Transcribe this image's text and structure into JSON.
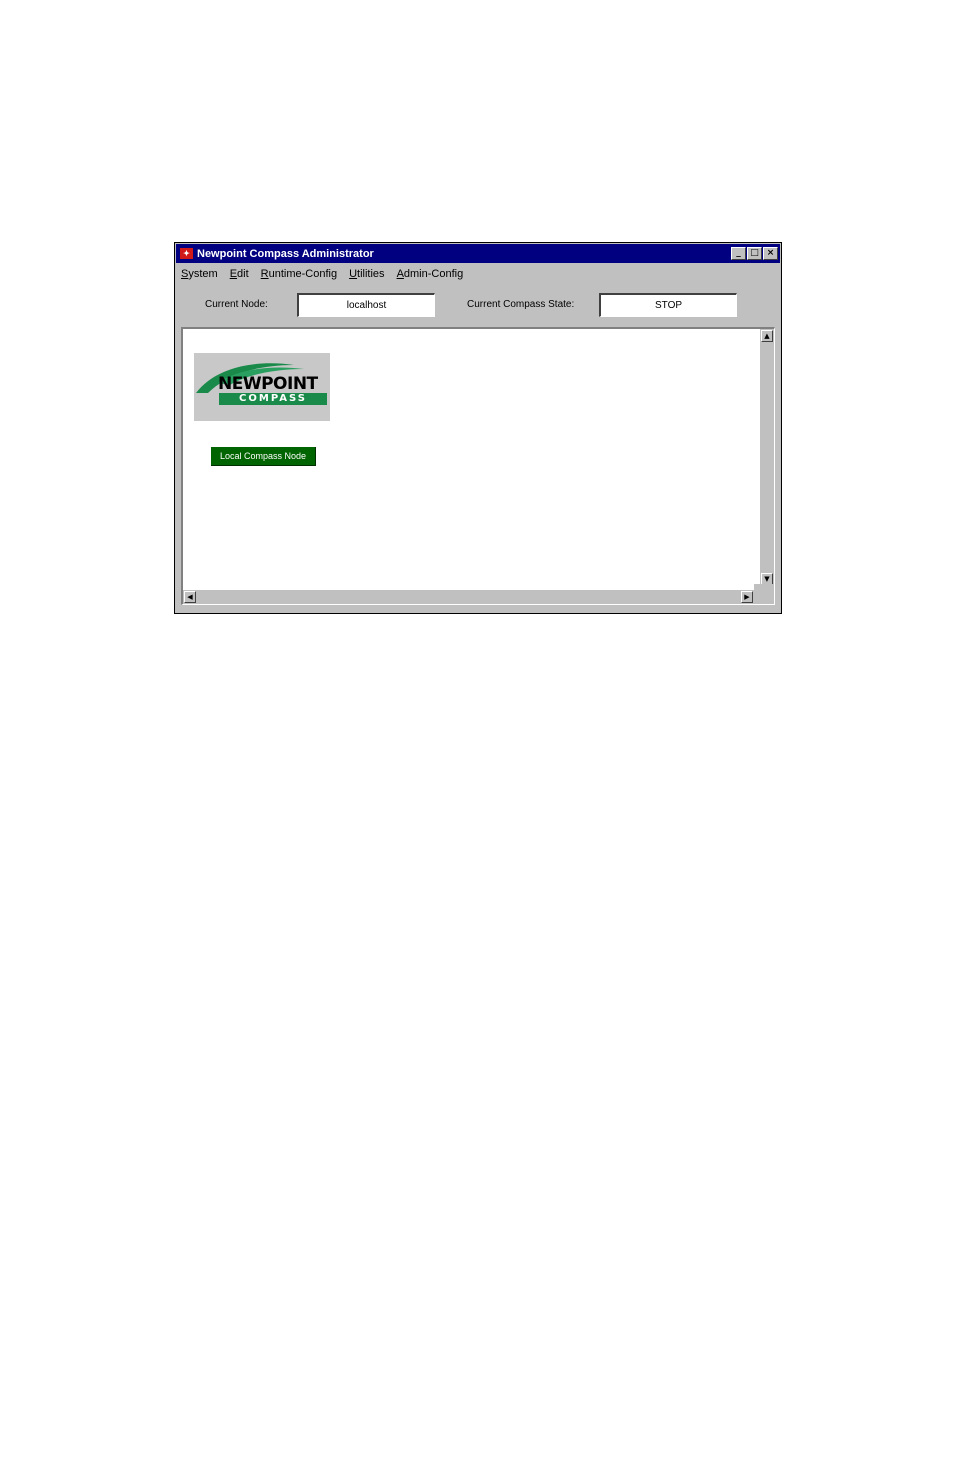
{
  "window": {
    "title": "Newpoint Compass Administrator",
    "app_icon": "app-icon",
    "controls": {
      "minimize": "_",
      "maximize": "□",
      "close": "×"
    }
  },
  "menu": [
    {
      "underline": "S",
      "rest": "ystem"
    },
    {
      "underline": "E",
      "rest": "dit"
    },
    {
      "underline": "R",
      "rest": "untime-Config"
    },
    {
      "underline": "U",
      "rest": "tilities"
    },
    {
      "underline": "A",
      "rest": "dmin-Config"
    }
  ],
  "status": {
    "node_label": "Current Node:",
    "node_value": "localhost",
    "state_label": "Current Compass State:",
    "state_value": "STOP"
  },
  "canvas": {
    "logo": {
      "word": "NEWPOINT",
      "sub": "COMPASS"
    },
    "node_button": "Local Compass Node"
  },
  "scroll": {
    "up": "▲",
    "down": "▼",
    "left": "◀",
    "right": "▶"
  },
  "colors": {
    "titlebar": "#000080",
    "window_face": "#c0c0c0",
    "node_button": "#006400",
    "logo_green": "#1a8a4a"
  }
}
